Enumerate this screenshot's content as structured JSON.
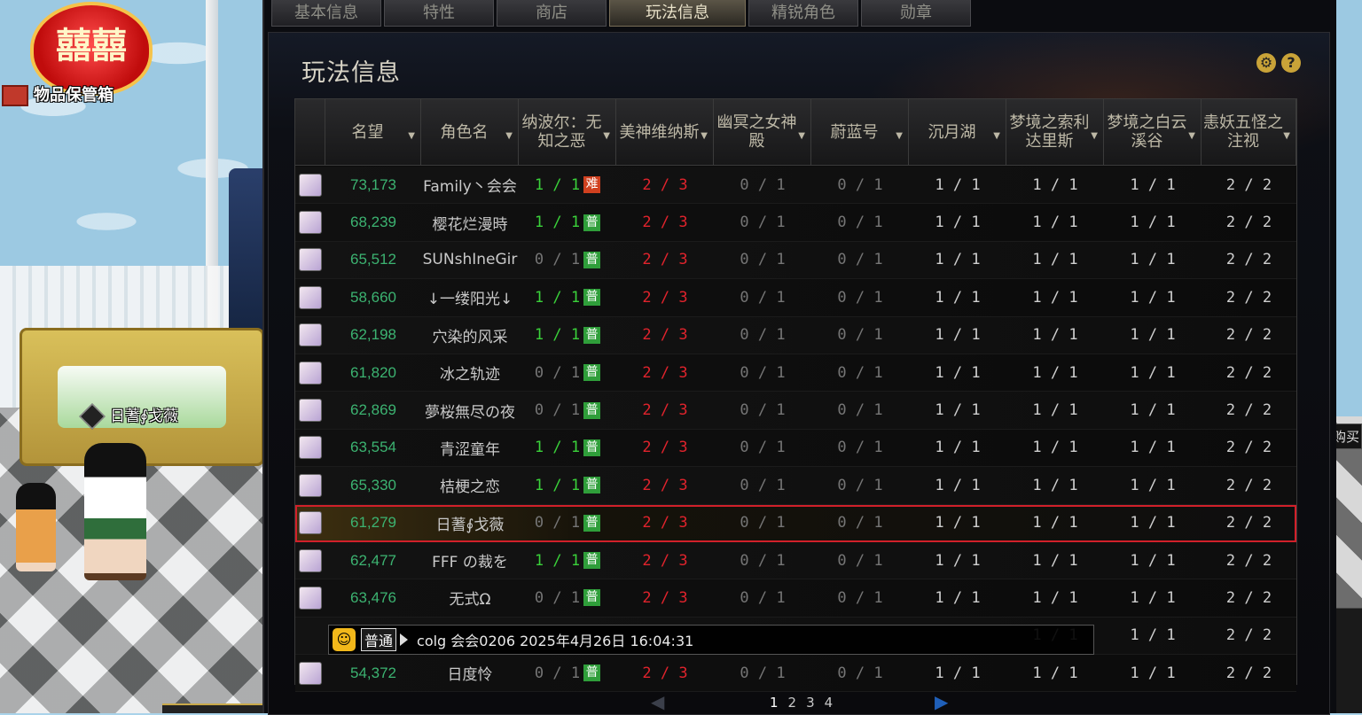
{
  "scene": {
    "wedding_icon": "囍囍",
    "storage_label": "物品保管箱",
    "character_name": "日蓍∮戈薇",
    "right_edge_label": "购买"
  },
  "tabs": [
    {
      "label": "基本信息",
      "active": false
    },
    {
      "label": "特性",
      "active": false
    },
    {
      "label": "商店",
      "active": false
    },
    {
      "label": "玩法信息",
      "active": true
    },
    {
      "label": "精锐角色",
      "active": false
    },
    {
      "label": "勋章",
      "active": false
    }
  ],
  "panel": {
    "title": "玩法信息",
    "settings_icon": "⚙",
    "help_icon": "?"
  },
  "table": {
    "headers": [
      {
        "label": "名望"
      },
      {
        "label": "角色名"
      },
      {
        "label": "纳波尔：无知之恶"
      },
      {
        "label": "美神维纳斯"
      },
      {
        "label": "幽冥之女神殿"
      },
      {
        "label": "蔚蓝号"
      },
      {
        "label": "沉月湖"
      },
      {
        "label": "梦境之索利达里斯"
      },
      {
        "label": "梦境之白云溪谷"
      },
      {
        "label": "恚妖五怪之注视"
      }
    ],
    "rows": [
      {
        "fame": "73,173",
        "name": "Family丶会会",
        "c1": "1 / 1",
        "c1_color": "green",
        "c1_badge": "难",
        "c1_badge_type": "nan",
        "c2": "2 / 3",
        "c3": "0 / 1",
        "c4": "0 / 1",
        "c5": "1 / 1",
        "c6": "1 / 1",
        "c7": "1 / 1",
        "c8": "2 / 2",
        "selected": false
      },
      {
        "fame": "68,239",
        "name": "樱花烂漫時",
        "c1": "1 / 1",
        "c1_color": "green",
        "c1_badge": "普",
        "c1_badge_type": "pu",
        "c2": "2 / 3",
        "c3": "0 / 1",
        "c4": "0 / 1",
        "c5": "1 / 1",
        "c6": "1 / 1",
        "c7": "1 / 1",
        "c8": "2 / 2",
        "selected": false
      },
      {
        "fame": "65,512",
        "name": "SUNshIneGir",
        "c1": "0 / 1",
        "c1_color": "gray",
        "c1_badge": "普",
        "c1_badge_type": "pu",
        "c2": "2 / 3",
        "c3": "0 / 1",
        "c4": "0 / 1",
        "c5": "1 / 1",
        "c6": "1 / 1",
        "c7": "1 / 1",
        "c8": "2 / 2",
        "selected": false
      },
      {
        "fame": "58,660",
        "name": "↓一缕阳光↓",
        "c1": "1 / 1",
        "c1_color": "green",
        "c1_badge": "普",
        "c1_badge_type": "pu",
        "c2": "2 / 3",
        "c3": "0 / 1",
        "c4": "0 / 1",
        "c5": "1 / 1",
        "c6": "1 / 1",
        "c7": "1 / 1",
        "c8": "2 / 2",
        "selected": false
      },
      {
        "fame": "62,198",
        "name": "穴染的风采",
        "c1": "1 / 1",
        "c1_color": "green",
        "c1_badge": "普",
        "c1_badge_type": "pu",
        "c2": "2 / 3",
        "c3": "0 / 1",
        "c4": "0 / 1",
        "c5": "1 / 1",
        "c6": "1 / 1",
        "c7": "1 / 1",
        "c8": "2 / 2",
        "selected": false
      },
      {
        "fame": "61,820",
        "name": "冰之轨迹",
        "c1": "0 / 1",
        "c1_color": "gray",
        "c1_badge": "普",
        "c1_badge_type": "pu",
        "c2": "2 / 3",
        "c3": "0 / 1",
        "c4": "0 / 1",
        "c5": "1 / 1",
        "c6": "1 / 1",
        "c7": "1 / 1",
        "c8": "2 / 2",
        "selected": false
      },
      {
        "fame": "62,869",
        "name": "夢桜無尽の夜",
        "c1": "0 / 1",
        "c1_color": "gray",
        "c1_badge": "普",
        "c1_badge_type": "pu",
        "c2": "2 / 3",
        "c3": "0 / 1",
        "c4": "0 / 1",
        "c5": "1 / 1",
        "c6": "1 / 1",
        "c7": "1 / 1",
        "c8": "2 / 2",
        "selected": false
      },
      {
        "fame": "63,554",
        "name": "青涩童年",
        "c1": "1 / 1",
        "c1_color": "green",
        "c1_badge": "普",
        "c1_badge_type": "pu",
        "c2": "2 / 3",
        "c3": "0 / 1",
        "c4": "0 / 1",
        "c5": "1 / 1",
        "c6": "1 / 1",
        "c7": "1 / 1",
        "c8": "2 / 2",
        "selected": false
      },
      {
        "fame": "65,330",
        "name": "桔梗之恋",
        "c1": "1 / 1",
        "c1_color": "green",
        "c1_badge": "普",
        "c1_badge_type": "pu",
        "c2": "2 / 3",
        "c3": "0 / 1",
        "c4": "0 / 1",
        "c5": "1 / 1",
        "c6": "1 / 1",
        "c7": "1 / 1",
        "c8": "2 / 2",
        "selected": false
      },
      {
        "fame": "61,279",
        "name": "日蓍∮戈薇",
        "c1": "0 / 1",
        "c1_color": "gray",
        "c1_badge": "普",
        "c1_badge_type": "pu",
        "c2": "2 / 3",
        "c3": "0 / 1",
        "c4": "0 / 1",
        "c5": "1 / 1",
        "c6": "1 / 1",
        "c7": "1 / 1",
        "c8": "2 / 2",
        "selected": true
      },
      {
        "fame": "62,477",
        "name": "FFF の裁を",
        "c1": "1 / 1",
        "c1_color": "green",
        "c1_badge": "普",
        "c1_badge_type": "pu",
        "c2": "2 / 3",
        "c3": "0 / 1",
        "c4": "0 / 1",
        "c5": "1 / 1",
        "c6": "1 / 1",
        "c7": "1 / 1",
        "c8": "2 / 2",
        "selected": false
      },
      {
        "fame": "63,476",
        "name": "无式Ω",
        "c1": "0 / 1",
        "c1_color": "gray",
        "c1_badge": "普",
        "c1_badge_type": "pu",
        "c2": "2 / 3",
        "c3": "0 / 1",
        "c4": "0 / 1",
        "c5": "1 / 1",
        "c6": "1 / 1",
        "c7": "1 / 1",
        "c8": "2 / 2",
        "selected": false
      },
      {
        "fame": "",
        "name": "",
        "c1": "",
        "c1_color": "gray",
        "c1_badge": "",
        "c1_badge_type": "pu",
        "c2": "",
        "c3": "",
        "c4": "",
        "c5": "",
        "c6": "1 / 1",
        "c7": "1 / 1",
        "c8": "2 / 2",
        "selected": false
      },
      {
        "fame": "54,372",
        "name": "日度怜",
        "c1": "0 / 1",
        "c1_color": "gray",
        "c1_badge": "普",
        "c1_badge_type": "pu",
        "c2": "2 / 3",
        "c3": "0 / 1",
        "c4": "0 / 1",
        "c5": "1 / 1",
        "c6": "1 / 1",
        "c7": "1 / 1",
        "c8": "2 / 2",
        "selected": false
      }
    ]
  },
  "pagination": {
    "prev_icon": "◀",
    "next_icon": "▶",
    "pages": [
      "1",
      "2",
      "3",
      "4"
    ],
    "current": "1"
  },
  "chat": {
    "channel": "普通",
    "message": "colg 会会0206 2025年4月26日 16:04:31"
  }
}
